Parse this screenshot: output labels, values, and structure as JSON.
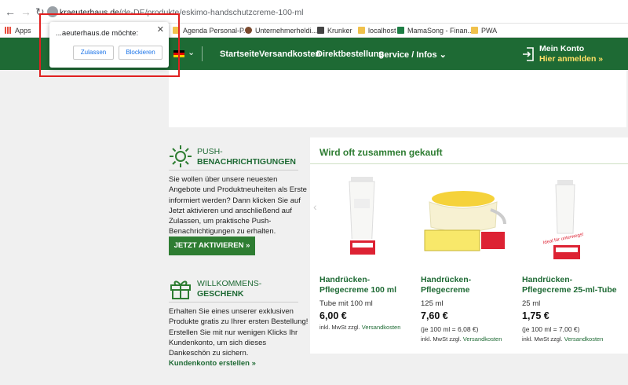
{
  "browser": {
    "url_host": "kraeuterhaus.de",
    "url_path": "/de-DE/produkte/eskimo-handschutzcreme-100-ml",
    "bookmarks": [
      {
        "label": "Apps",
        "color": "#e74c3c"
      },
      {
        "label": "Agenda Personal-P...",
        "color": "#f0c14b"
      },
      {
        "label": "Unternehmerheldi...",
        "color": "#7b4a2e"
      },
      {
        "label": "Krunker",
        "color": "#444444"
      },
      {
        "label": "localhost",
        "color": "#f0c14b"
      },
      {
        "label": "MamaSong - Finan...",
        "color": "#1e7e45"
      },
      {
        "label": "PWA",
        "color": "#f0c14b"
      }
    ]
  },
  "popup": {
    "message": "...aeuterhaus.de möchte:",
    "allow_label": "Zulassen",
    "block_label": "Blockieren"
  },
  "header": {
    "nav": [
      "Startseite",
      "Versandkosten",
      "Direktbestellung",
      "Service / Infos ⌄"
    ],
    "account_line1": "Mein Konto",
    "account_line2": "Hier anmelden »"
  },
  "push": {
    "title_line1": "PUSH-",
    "title_line2": "BENACHRICHTIGUNGEN",
    "text_lines": [
      "Sie wollen über unsere neuesten",
      "Angebote und Produktneuheiten als Erste",
      "informiert werden? Dann klicken Sie auf",
      "Jetzt aktivieren und anschließend auf",
      "Zulassen, um praktische Push-",
      "Benachrichtigungen zu erhalten."
    ],
    "button": "JETZT AKTIVIEREN »"
  },
  "welcome": {
    "title_line1": "WILLKOMMENS-",
    "title_line2": "GESCHENK",
    "text_lines": [
      "Erhalten Sie eines unserer exklusiven",
      "Produkte gratis zu Ihrer ersten Bestellung!",
      "Erstellen Sie mit nur wenigen Klicks Ihr",
      "Kundenkonto, um sich dieses",
      "Dankeschön zu sichern."
    ],
    "link": "Kundenkonto erstellen »"
  },
  "related": {
    "title": "Wird oft zusammen gekauft",
    "products": [
      {
        "name_line1": "Handrücken-",
        "name_line2": "Pflegecreme 100 ml",
        "size": "Tube mit 100 ml",
        "price": "6,00 €",
        "unit": "",
        "tax": "inkl. MwSt zzgl.",
        "shipping": "Versandkosten"
      },
      {
        "name_line1": "Handrücken-",
        "name_line2": "Pflegecreme",
        "size": "125 ml",
        "price": "7,60 €",
        "unit": "(je 100 ml = 6,08 €)",
        "tax": "inkl. MwSt zzgl.",
        "shipping": "Versandkosten"
      },
      {
        "name_line1": "Handrücken-",
        "name_line2": "Pflegecreme 25-ml-Tube",
        "size": "25 ml",
        "price": "1,75 €",
        "unit": "(je 100 ml = 7,00 €)",
        "tax": "inkl. MwSt zzgl.",
        "shipping": "Versandkosten"
      }
    ]
  }
}
